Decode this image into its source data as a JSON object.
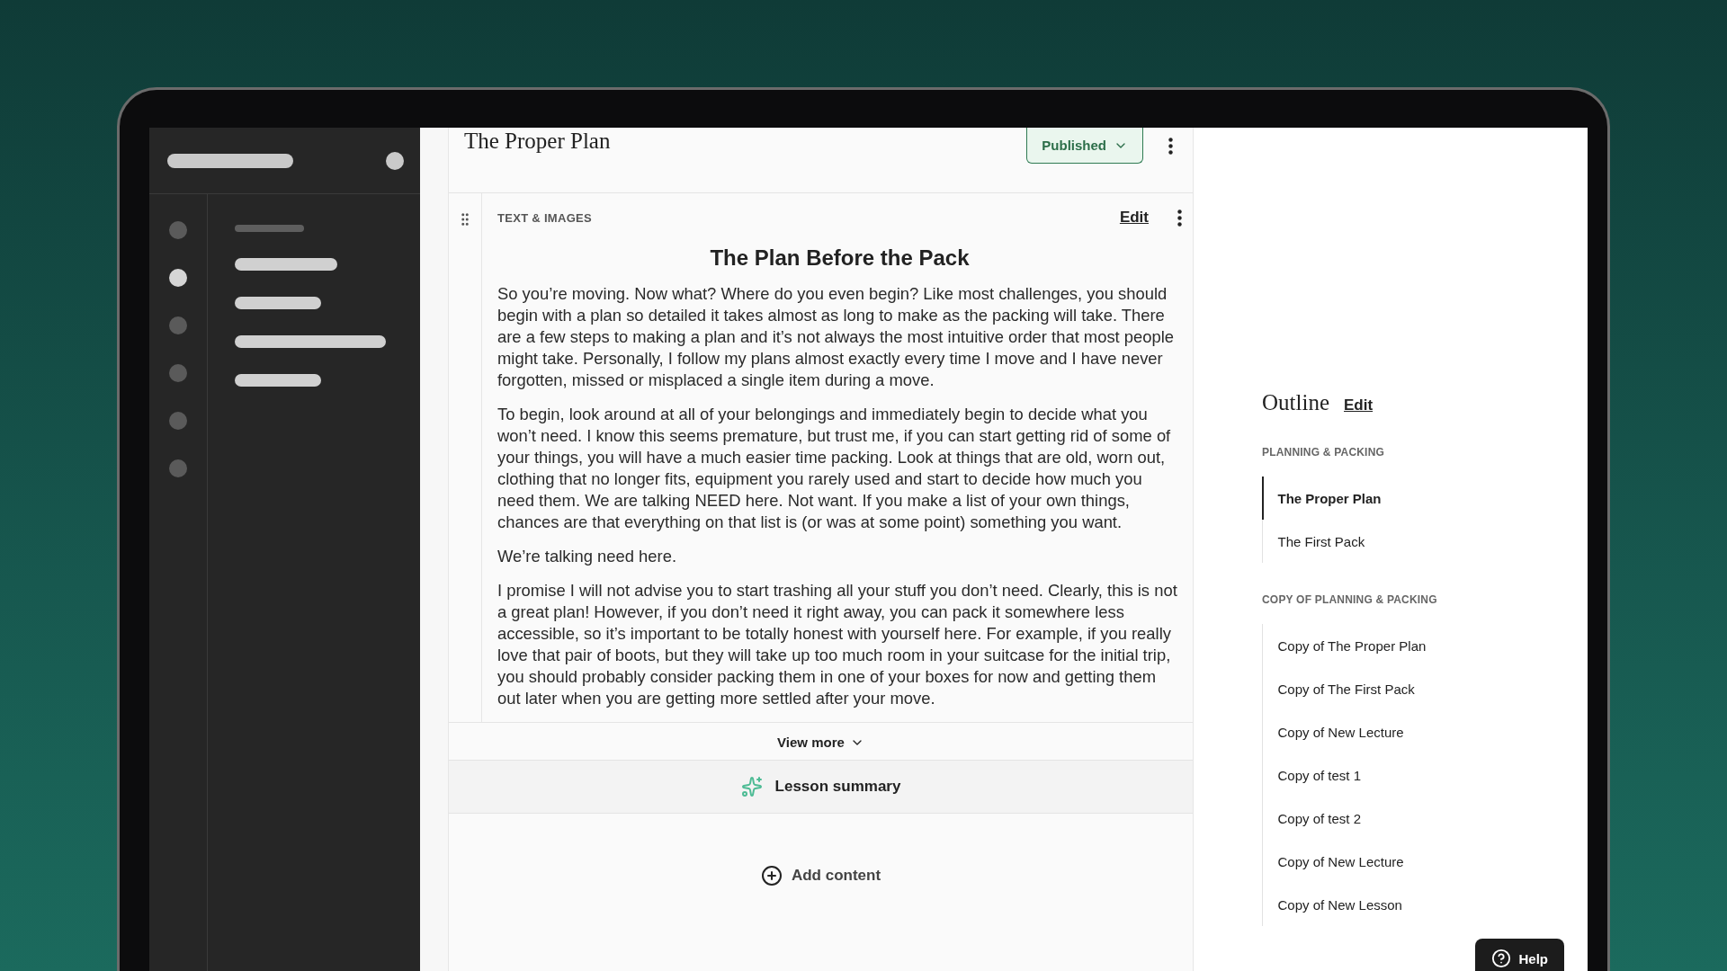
{
  "page": {
    "title": "The Proper Plan",
    "status": "Published"
  },
  "block": {
    "type_label": "TEXT & IMAGES",
    "edit": "Edit",
    "heading": "The Plan Before the Pack",
    "paragraphs": [
      "So you’re moving. Now what? Where do you even begin? Like most challenges, you should begin with a plan so detailed it takes almost as long to make as the packing will take. There are a few steps to making a plan and it’s not always the most intuitive order that most people might take. Personally, I follow my plans almost exactly every time I move and I have never forgotten, missed or misplaced a single item during a move.",
      "To begin, look around at all of your belongings and immediately begin to decide what you won’t need. I know this seems premature, but trust me, if you can start getting rid of some of your things, you will have a much easier time packing. Look at things that are old, worn out, clothing that no longer fits, equipment you rarely used and start to decide how much you need them. We are talking NEED here. Not want. If you make a list of your own things, chances are that everything on that list is (or was at some point) something you want.",
      "We’re talking need here.",
      "I promise I will not advise you to start trashing all your stuff you don’t need. Clearly, this is not a great plan! However, if you don’t need it right away, you can pack it somewhere less accessible, so it’s important to be totally honest with yourself here. For example, if you really love that pair of boots, but they will take up too much room in your suitcase for the initial trip, you should probably consider packing them in one of your boxes for now and getting them out later when you are getting more settled after your move."
    ],
    "view_more": "View more"
  },
  "lesson_summary": "Lesson summary",
  "add_content": "Add content",
  "outline": {
    "title": "Outline",
    "edit": "Edit",
    "sections": [
      {
        "title": "PLANNING & PACKING",
        "items": [
          {
            "label": "The Proper Plan",
            "selected": true
          },
          {
            "label": "The First Pack",
            "selected": false
          }
        ]
      },
      {
        "title": "COPY OF PLANNING & PACKING",
        "items": [
          {
            "label": "Copy of The Proper Plan",
            "selected": false
          },
          {
            "label": "Copy of The First Pack",
            "selected": false
          },
          {
            "label": "Copy of New Lecture",
            "selected": false
          },
          {
            "label": "Copy of test 1",
            "selected": false
          },
          {
            "label": "Copy of test 2",
            "selected": false
          },
          {
            "label": "Copy of New Lecture",
            "selected": false
          },
          {
            "label": "Copy of New Lesson",
            "selected": false
          }
        ]
      }
    ]
  },
  "help": "Help"
}
